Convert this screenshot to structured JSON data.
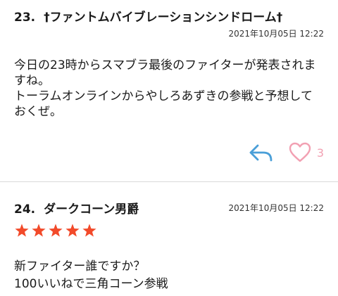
{
  "comments": [
    {
      "number": "23.",
      "author": "†ファントムバイブレーションシンドローム†",
      "date": "2021年10月05日 12:22",
      "text": "今日の23時からスマブラ最後のファイターが発表されますね。\nトーラムオンラインからやしろあずきの参戦と予想しておくぜ。",
      "like_count": "3",
      "reply_icon": "reply-icon",
      "like_icon": "heart-icon",
      "colors": {
        "reply": "#4a9fd8",
        "heart": "#f2a0b2"
      }
    },
    {
      "number": "24.",
      "author": "ダークコーン男爵",
      "date": "2021年10月05日 12:22",
      "rating": 5,
      "rating_max": 5,
      "star_color": "#f24a2a",
      "text": "新ファイター誰ですか？\n100いいねで三角コーン参戦"
    }
  ]
}
